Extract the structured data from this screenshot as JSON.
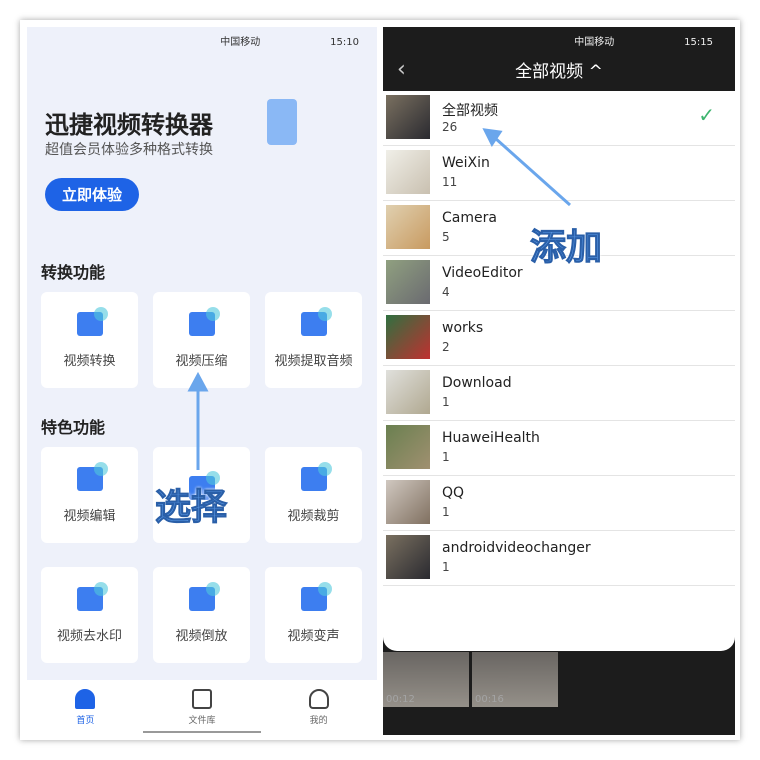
{
  "left": {
    "status": {
      "carrier": "中国移动",
      "time": "15:10"
    },
    "banner": {
      "title": "迅捷视频转换器",
      "subtitle": "超值会员体验多种格式转换",
      "cta": "立即体验"
    },
    "sections": [
      {
        "title": "转换功能",
        "items": [
          "视频转换",
          "视频压缩",
          "视频提取音频"
        ]
      },
      {
        "title": "特色功能",
        "items": [
          "视频编辑",
          "",
          "视频裁剪",
          "视频去水印",
          "视频倒放",
          "视频变声"
        ]
      }
    ],
    "nav": [
      {
        "label": "首页",
        "icon": "home-icon"
      },
      {
        "label": "文件库",
        "icon": "video-file-icon"
      },
      {
        "label": "我的",
        "icon": "user-icon"
      }
    ]
  },
  "right": {
    "status": {
      "carrier": "中国移动",
      "time": "15:15"
    },
    "header": {
      "title": "全部视频 ^"
    },
    "albums": [
      {
        "name": "全部视频",
        "count": "26",
        "selected": true
      },
      {
        "name": "WeiXin",
        "count": "11"
      },
      {
        "name": "Camera",
        "count": "5"
      },
      {
        "name": "VideoEditor",
        "count": "4"
      },
      {
        "name": "works",
        "count": "2"
      },
      {
        "name": "Download",
        "count": "1"
      },
      {
        "name": "HuaweiHealth",
        "count": "1"
      },
      {
        "name": "QQ",
        "count": "1"
      },
      {
        "name": "androidvideochanger",
        "count": "1"
      }
    ],
    "background_clips": [
      "00:12",
      "00:16"
    ]
  },
  "annotations": {
    "select": "选择",
    "add": "添加"
  },
  "colors": {
    "accent": "#1e63e6",
    "check": "#3cb46e",
    "annotation": "#5b9be8"
  }
}
